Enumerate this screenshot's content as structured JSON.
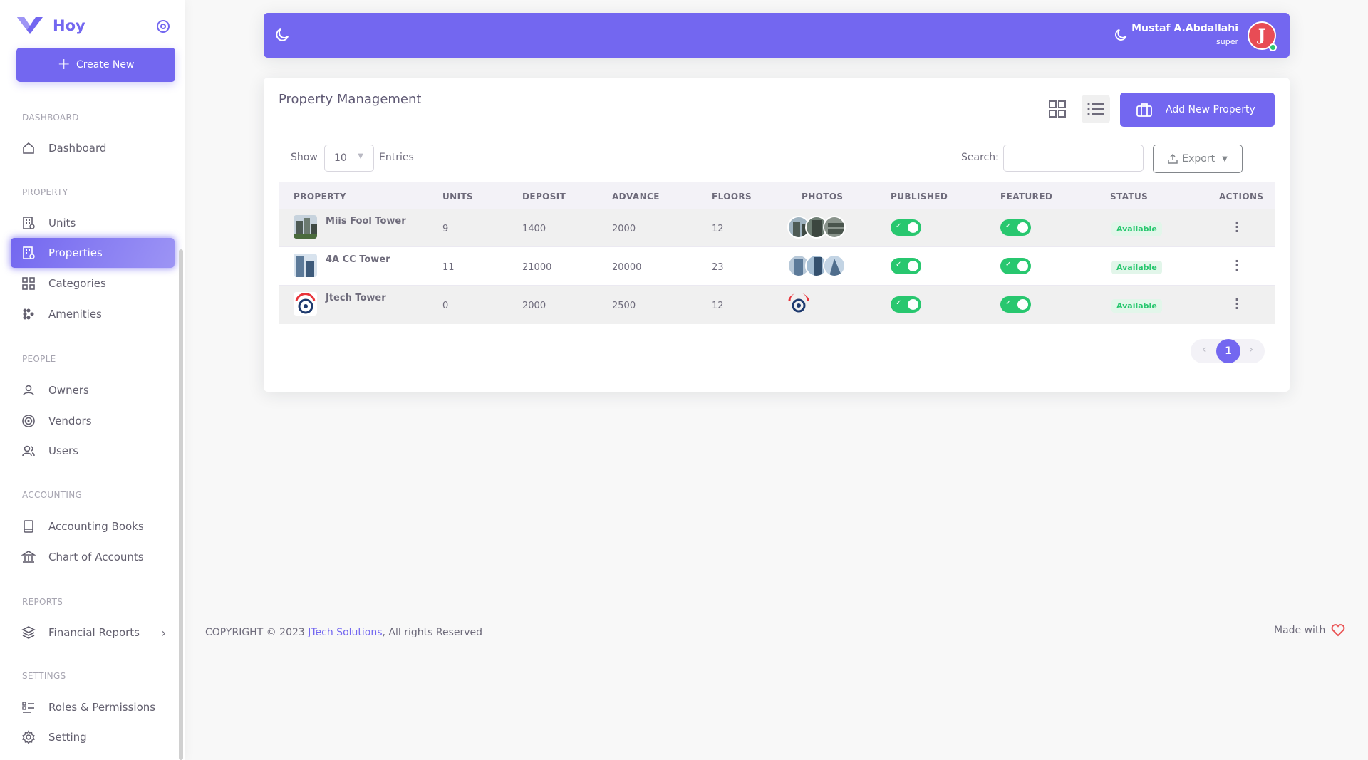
{
  "brand": {
    "name": "Hoy",
    "create_label": "Create New"
  },
  "sidebar": {
    "sections": [
      {
        "header": "DASHBOARD",
        "items": [
          {
            "label": "Dashboard",
            "icon": "home-icon"
          }
        ]
      },
      {
        "header": "PROPERTY",
        "items": [
          {
            "label": "Units",
            "icon": "building-icon"
          },
          {
            "label": "Properties",
            "icon": "building-check-icon",
            "active": true
          },
          {
            "label": "Categories",
            "icon": "grid-icon"
          },
          {
            "label": "Amenities",
            "icon": "apps-icon"
          }
        ]
      },
      {
        "header": "PEOPLE",
        "items": [
          {
            "label": "Owners",
            "icon": "user-icon"
          },
          {
            "label": "Vendors",
            "icon": "target-icon"
          },
          {
            "label": "Users",
            "icon": "users-icon"
          }
        ]
      },
      {
        "header": "ACCOUNTING",
        "items": [
          {
            "label": "Accounting Books",
            "icon": "book-icon"
          },
          {
            "label": "Chart of Accounts",
            "icon": "bank-icon"
          }
        ]
      },
      {
        "header": "REPORTS",
        "items": [
          {
            "label": "Financial Reports",
            "icon": "layers-icon"
          }
        ]
      },
      {
        "header": "SETTINGS",
        "items": [
          {
            "label": "Roles & Permissions",
            "icon": "list-check-icon"
          },
          {
            "label": "Setting",
            "icon": "gear-icon"
          }
        ]
      }
    ]
  },
  "navbar": {
    "user_name": "Mustaf A.Abdallahi",
    "user_role": "super",
    "avatar_letter": "J"
  },
  "main": {
    "title": "Property Management",
    "add_label": "Add New Property",
    "show_label": "Show",
    "entries_value": "10",
    "entries_label": "Entries",
    "search_label": "Search:",
    "export_label": "Export",
    "columns": [
      "PROPERTY",
      "UNITS",
      "DEPOSIT",
      "ADVANCE",
      "FLOORS",
      "PHOTOS",
      "PUBLISHED",
      "FEATURED",
      "STATUS",
      "ACTIONS"
    ],
    "rows": [
      {
        "name": "Miis Fool Tower",
        "units": "9",
        "deposit": "1400",
        "advance": "2000",
        "floors": "12",
        "published": true,
        "featured": true,
        "status": "Available"
      },
      {
        "name": "4A CC Tower",
        "units": "11",
        "deposit": "21000",
        "advance": "20000",
        "floors": "23",
        "published": true,
        "featured": true,
        "status": "Available"
      },
      {
        "name": "Jtech Tower",
        "units": "0",
        "deposit": "2000",
        "advance": "2500",
        "floors": "12",
        "published": true,
        "featured": true,
        "status": "Available"
      }
    ],
    "pagination": {
      "current": "1",
      "prev": "‹",
      "next": "›"
    }
  },
  "footer": {
    "copyright_prefix": "COPYRIGHT © 2023 ",
    "company": "JTech Solutions",
    "copyright_suffix": ", All rights Reserved",
    "made_with": "Made with"
  },
  "colors": {
    "primary": "#7367f0",
    "success": "#28c76f"
  }
}
